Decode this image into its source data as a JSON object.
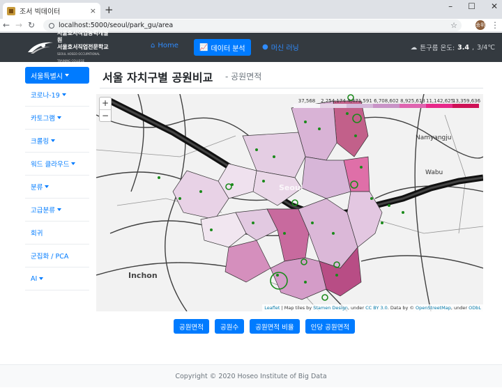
{
  "browser": {
    "tab_title": "조서 빅데이터",
    "tab_close": "×",
    "new_tab": "+",
    "win_minimize": "–",
    "win_maximize": "☐",
    "win_close": "✕",
    "url": "localhost:5000/seoul/park_gu/area",
    "profile_initials": "송위"
  },
  "navbar": {
    "logo_line1": "서울호서직업능력개발원",
    "logo_line2": "서울호서직업전문학교",
    "logo_line3": "SEOUL HOSEO OCCUPATIONAL TRAINING COLLEGE",
    "home": "Home",
    "analysis": "데이터 분석",
    "ml": "머신 러닝",
    "weather_label": "튼구름 온도:",
    "weather_temp": "3.4",
    "weather_range": "3/4℃"
  },
  "sidebar": {
    "active": "서울특별시",
    "items": [
      "코로나-19",
      "카토그램",
      "크롤링",
      "워드 클라우드",
      "분류",
      "고급분류",
      "회귀",
      "군집화 / PCA",
      "AI"
    ],
    "carets": [
      true,
      true,
      true,
      true,
      true,
      true,
      false,
      false,
      true
    ]
  },
  "main": {
    "title": "서울 자치구별 공원비교",
    "subtitle": "- 공원면적"
  },
  "map": {
    "zoom_in": "+",
    "zoom_out": "−",
    "legend_ticks": [
      "37,568",
      "2,254,174",
      "4,471,591",
      "6,708,602",
      "8,925,613",
      "11,142,625",
      "13,359,636"
    ],
    "legend_colors": [
      "#f7f4f9",
      "#e7d4e8",
      "#d4b9da",
      "#c994c7",
      "#df65b0",
      "#e7298a",
      "#ce1256"
    ],
    "labels": {
      "namyangju": "Namyangju",
      "wabu": "Wabu",
      "incheon": "Inchon",
      "seoul": "Seoul"
    },
    "attribution": {
      "leaflet": "Leaflet",
      "t1": " | Map tiles by ",
      "stamen": "Stamen Design",
      "t2": ", under ",
      "cc": "CC BY 3.0",
      "t3": ". Data by © ",
      "osm": "OpenStreetMap",
      "t4": ", under ",
      "odbl": "ODbL"
    }
  },
  "buttons": [
    "공원면적",
    "공원수",
    "공원면적 비율",
    "인당 공원면적"
  ],
  "footer": "Copyright © 2020 Hoseo Institute of Big Data"
}
